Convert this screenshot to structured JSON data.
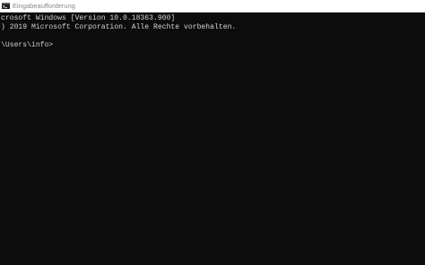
{
  "window": {
    "title": "Eingabeaufforderung",
    "icon": "console-icon"
  },
  "console": {
    "lines": [
      "crosoft Windows [Version 10.0.18363.900]",
      ") 2019 Microsoft Corporation. Alle Rechte vorbehalten.",
      "",
      "\\Users\\info>"
    ]
  },
  "colors": {
    "background": "#0c0c0c",
    "text": "#d4d4d4",
    "titlebar": "#ffffff",
    "title_text": "#8a8a8a"
  }
}
